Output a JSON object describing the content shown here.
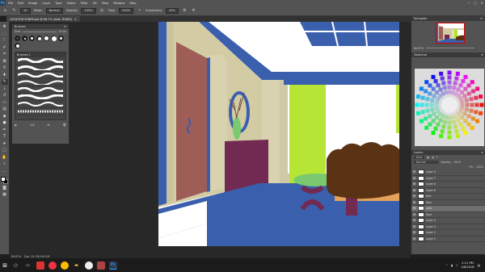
{
  "menubar": {
    "app": "Ps",
    "items": [
      "File",
      "Edit",
      "Image",
      "Layer",
      "Type",
      "Select",
      "Filter",
      "3D",
      "View",
      "Window",
      "Help"
    ],
    "window_controls": [
      "—",
      "▢",
      "✕"
    ]
  },
  "options": {
    "mode_label": "Mode:",
    "mode_value": "Normal",
    "opacity_label": "Opacity:",
    "opacity_value": "100%",
    "flow_label": "Flow:",
    "flow_value": "100%",
    "smoothing_label": "Smoothing:",
    "smoothing_value": "10%",
    "brush_size": "10"
  },
  "tab": {
    "title": "LOCATION SUNRF.psd @ 66.7% (walk, RGB/8)",
    "close": "×"
  },
  "brush_panel": {
    "title": "Brushes",
    "size_label": "Size:",
    "size_value": "10 px",
    "folder": "Brushes 1",
    "footer_count": "1/4"
  },
  "navigator": {
    "title": "Navigator",
    "zoom": "66.67%"
  },
  "swatches": {
    "title": "Swatches"
  },
  "layers": {
    "title": "Layers",
    "kind_label": "Kind",
    "blend_mode": "Normal",
    "opacity_label": "Opacity:",
    "opacity_value": "100%",
    "fill_label": "Fill:",
    "fill_value": "100%",
    "items": [
      {
        "name": "Layer 9"
      },
      {
        "name": "Layer 7"
      },
      {
        "name": "Layer 8"
      },
      {
        "name": "Layer 6"
      },
      {
        "name": "fore"
      },
      {
        "name": "floor"
      },
      {
        "name": "walk"
      },
      {
        "name": "floor"
      },
      {
        "name": "Layer 4"
      },
      {
        "name": "Layer 3"
      },
      {
        "name": "Layer 2"
      },
      {
        "name": "Layer 1"
      }
    ]
  },
  "status": {
    "zoom": "66.67%",
    "doc": "Doc: 24.7M/194.5M"
  },
  "taskbar": {
    "time": "2:11 PM",
    "date": "2/6/2018"
  },
  "colors": {
    "canvas_blue": "#3a5fad",
    "door": "#9e5d57",
    "cabinet": "#722a52",
    "curtain": "#b7e535",
    "wall": "#d2cba3"
  }
}
